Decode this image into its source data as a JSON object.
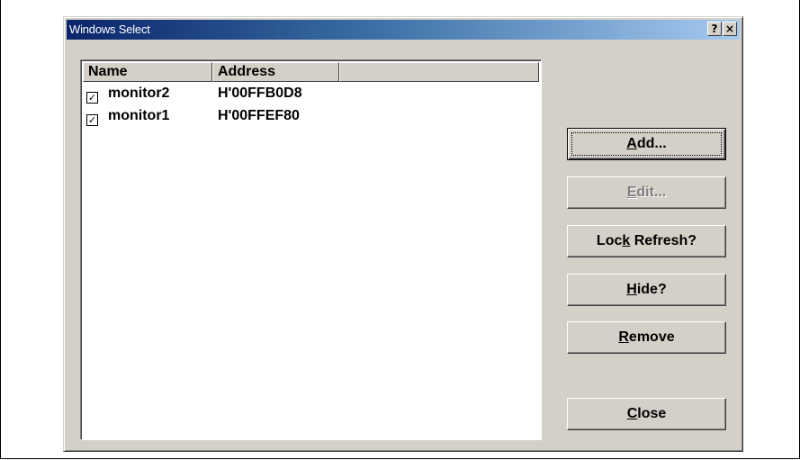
{
  "window": {
    "title": "Windows Select",
    "help_label": "?",
    "close_label": "×"
  },
  "list": {
    "columns": [
      "Name",
      "Address",
      ""
    ],
    "rows": [
      {
        "checked": true,
        "name": "monitor2",
        "address": "H'00FFB0D8"
      },
      {
        "checked": true,
        "name": "monitor1",
        "address": "H'00FFEF80"
      }
    ]
  },
  "buttons": {
    "add": {
      "pre": "",
      "key": "A",
      "post": "dd..."
    },
    "edit": {
      "pre": "",
      "key": "E",
      "post": "dit...",
      "disabled": true
    },
    "lock_refresh": {
      "pre": "Loc",
      "key": "k",
      "post": " Refresh?"
    },
    "hide": {
      "pre": "",
      "key": "H",
      "post": "ide?"
    },
    "remove": {
      "pre": "",
      "key": "R",
      "post": "emove"
    },
    "close": {
      "pre": "",
      "key": "C",
      "post": "lose"
    }
  },
  "icons": {
    "check": "✓"
  }
}
